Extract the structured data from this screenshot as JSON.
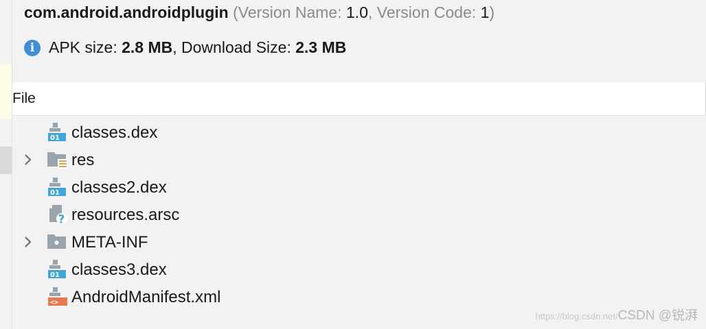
{
  "header": {
    "package_name": "com.android.androidplugin",
    "version_open": " (Version Name: ",
    "version_name": "1.0",
    "version_mid": ", Version Code: ",
    "version_code": "1",
    "version_close": ")"
  },
  "size_info": {
    "apk_label": "APK size: ",
    "apk_value": "2.8 MB",
    "sep": ", Download Size: ",
    "download_value": "2.3 MB",
    "icon": "info-icon"
  },
  "table": {
    "column_header": "File"
  },
  "tree": [
    {
      "label": "classes.dex",
      "icon": "dex-file-icon",
      "expandable": false
    },
    {
      "label": "res",
      "icon": "resource-folder-icon",
      "expandable": true
    },
    {
      "label": "classes2.dex",
      "icon": "dex-file-icon",
      "expandable": false
    },
    {
      "label": "resources.arsc",
      "icon": "unknown-file-icon",
      "expandable": false
    },
    {
      "label": "META-INF",
      "icon": "folder-icon",
      "expandable": true
    },
    {
      "label": "classes3.dex",
      "icon": "dex-file-icon",
      "expandable": false
    },
    {
      "label": "AndroidManifest.xml",
      "icon": "xml-file-icon",
      "expandable": false
    }
  ],
  "watermark": {
    "url": "https://blog.csdn.net/",
    "text": "CSDN @锐湃"
  },
  "colors": {
    "info_blue": "#3d8fd9",
    "dex_blue": "#40a6d9",
    "xml_orange": "#e8794a",
    "folder_gray": "#9aa4ad"
  }
}
